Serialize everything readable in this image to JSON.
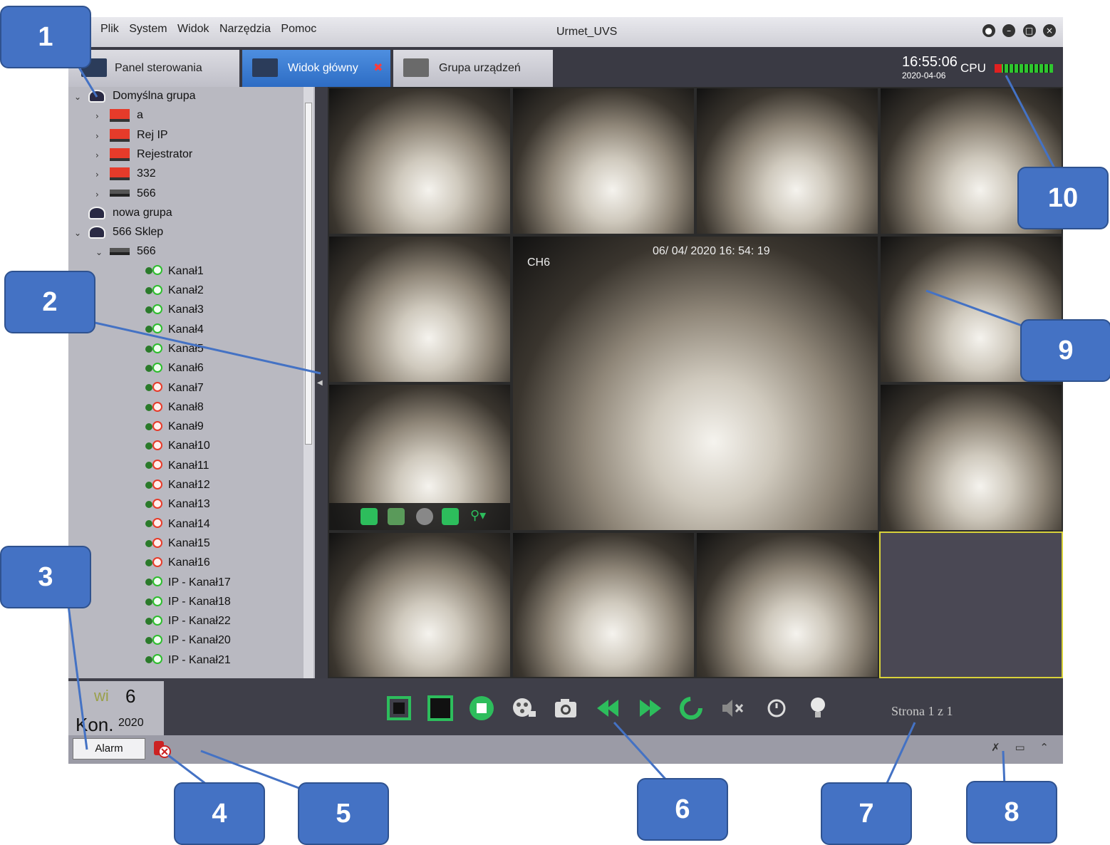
{
  "window": {
    "title": "Urmet_UVS",
    "menu": [
      "Plik",
      "System",
      "Widok",
      "Narzędzia",
      "Pomoc"
    ]
  },
  "tabs": [
    {
      "label": "Panel sterowania",
      "active": false
    },
    {
      "label": "Widok główny",
      "active": true
    },
    {
      "label": "Grupa urządzeń",
      "active": false
    }
  ],
  "status_top": {
    "time": "16:55:06",
    "date": "2020-04-06",
    "cpu_label": "CPU"
  },
  "tree": {
    "items": [
      {
        "label": "Domyślna grupa",
        "type": "group",
        "expanded": true
      },
      {
        "label": "a",
        "type": "dvr"
      },
      {
        "label": "Rej IP",
        "type": "dvr"
      },
      {
        "label": "Rejestrator",
        "type": "dvr"
      },
      {
        "label": "332",
        "type": "dvr"
      },
      {
        "label": "566",
        "type": "nvr"
      },
      {
        "label": "nowa grupa",
        "type": "group"
      },
      {
        "label": "566 Sklep",
        "type": "group",
        "expanded": true
      },
      {
        "label": "566",
        "type": "nvr",
        "expanded": true
      },
      {
        "label": "Kanał1",
        "type": "channel",
        "state": "online"
      },
      {
        "label": "Kanał2",
        "type": "channel",
        "state": "online"
      },
      {
        "label": "Kanał3",
        "type": "channel",
        "state": "online"
      },
      {
        "label": "Kanał4",
        "type": "channel",
        "state": "online"
      },
      {
        "label": "Kanał5",
        "type": "channel",
        "state": "online"
      },
      {
        "label": "Kanał6",
        "type": "channel",
        "state": "online"
      },
      {
        "label": "Kanał7",
        "type": "channel",
        "state": "offline"
      },
      {
        "label": "Kanał8",
        "type": "channel",
        "state": "offline"
      },
      {
        "label": "Kanał9",
        "type": "channel",
        "state": "offline"
      },
      {
        "label": "Kanał10",
        "type": "channel",
        "state": "offline"
      },
      {
        "label": "Kanał11",
        "type": "channel",
        "state": "offline"
      },
      {
        "label": "Kanał12",
        "type": "channel",
        "state": "offline"
      },
      {
        "label": "Kanał13",
        "type": "channel",
        "state": "offline"
      },
      {
        "label": "Kanał14",
        "type": "channel",
        "state": "offline"
      },
      {
        "label": "Kanał15",
        "type": "channel",
        "state": "offline"
      },
      {
        "label": "Kanał16",
        "type": "channel",
        "state": "offline"
      },
      {
        "label": "IP - Kanał17",
        "type": "channel",
        "state": "online"
      },
      {
        "label": "IP - Kanał18",
        "type": "channel",
        "state": "online"
      },
      {
        "label": "IP - Kanał22",
        "type": "channel",
        "state": "online"
      },
      {
        "label": "IP - Kanał20",
        "type": "channel",
        "state": "online"
      },
      {
        "label": "IP - Kanał21",
        "type": "channel",
        "state": "online"
      }
    ]
  },
  "video": {
    "big_osd_datetime": "06/ 04/ 2020  16: 54: 19",
    "big_osd_channel": "CH6",
    "selected_empty_cell": true
  },
  "bottom": {
    "weekday": "wi",
    "day": "6",
    "month": "Kon.",
    "year": "2020",
    "page_label": "Strona 1 z 1",
    "toolbar": [
      "fullscreen-icon",
      "layout-icon",
      "stop-all-icon",
      "record-icon",
      "snapshot-icon",
      "prev-page-icon",
      "next-page-icon",
      "cycle-icon",
      "mute-icon",
      "timer-icon",
      "light-icon"
    ]
  },
  "status": {
    "alarm_label": "Alarm"
  },
  "callouts": [
    "1",
    "2",
    "3",
    "4",
    "5",
    "6",
    "7",
    "8",
    "9",
    "10"
  ],
  "colors": {
    "accent": "#4472c4",
    "tab_active": "#2d6cc4",
    "cpu_ok": "#2ec62e",
    "cpu_hot": "#e02020"
  }
}
